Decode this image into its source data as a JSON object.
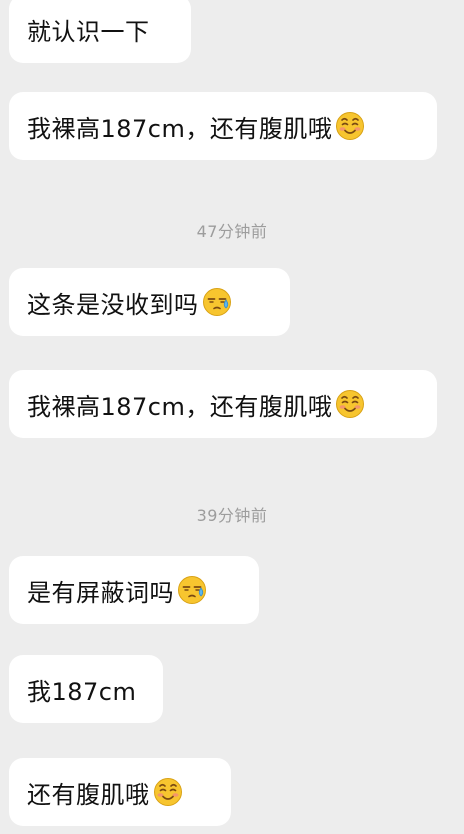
{
  "messages": [
    {
      "text": "就认识一下",
      "emoji": ""
    },
    {
      "text": "我裸高187cm，还有腹肌哦",
      "emoji": "smile-blush-emoji-icon"
    },
    {
      "text": "这条是没收到吗",
      "emoji": "sweat-emoji-icon"
    },
    {
      "text": "我裸高187cm，还有腹肌哦",
      "emoji": "smile-blush-emoji-icon"
    },
    {
      "text": "是有屏蔽词吗",
      "emoji": "sweat-emoji-icon"
    },
    {
      "text": "我187cm",
      "emoji": ""
    },
    {
      "text": "还有腹肌哦",
      "emoji": "smile-blush-emoji-icon"
    }
  ],
  "timestamps": [
    {
      "text": "47分钟前"
    },
    {
      "text": "39分钟前"
    }
  ],
  "colors": {
    "background": "#ededed",
    "bubble": "#ffffff",
    "text": "#111111",
    "timestamp": "#9d9d9d",
    "emoji_face": "#f7c52f"
  }
}
